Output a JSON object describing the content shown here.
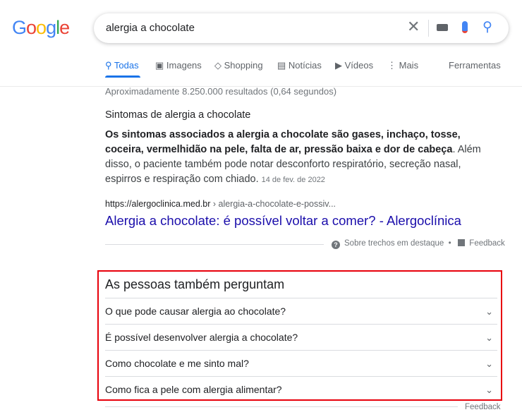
{
  "logo": "Google",
  "search": {
    "query": "alergia a chocolate"
  },
  "tabs": [
    {
      "label": "Todas",
      "icon": "search-icon"
    },
    {
      "label": "Imagens",
      "icon": "image-icon"
    },
    {
      "label": "Shopping",
      "icon": "tag-icon"
    },
    {
      "label": "Notícias",
      "icon": "news-icon"
    },
    {
      "label": "Vídeos",
      "icon": "play-icon"
    },
    {
      "label": "Mais",
      "icon": "more-vertical-icon"
    }
  ],
  "tools_label": "Ferramentas",
  "stats": "Aproximadamente 8.250.000 resultados (0,64 segundos)",
  "snippet": {
    "heading": "Sintomas de alergia a chocolate",
    "bold": "Os sintomas associados a alergia a chocolate são gases, inchaço, tosse, coceira, vermelhidão na pele, falta de ar, pressão baixa e dor de cabeça",
    "rest": ". Além disso, o paciente também pode notar desconforto respiratório, secreção nasal, espirros e respiração com chiado.",
    "date": "14 de fev. de 2022",
    "url_domain": "https://alergoclinica.med.br",
    "url_path": " › alergia-a-chocolate-e-possiv...",
    "title": "Alergia a chocolate: é possível voltar a comer? - Alergoclínica",
    "about": "Sobre trechos em destaque",
    "dot": "•",
    "feedback": "Feedback"
  },
  "paa": {
    "heading": "As pessoas também perguntam",
    "questions": [
      "O que pode causar alergia ao chocolate?",
      "É possível desenvolver alergia a chocolate?",
      "Como chocolate e me sinto mal?",
      "Como fica a pele com alergia alimentar?"
    ],
    "feedback": "Feedback"
  },
  "colors": {
    "link": "#1a0dab",
    "active_tab": "#1a73e8",
    "highlight": "#e8000b"
  }
}
